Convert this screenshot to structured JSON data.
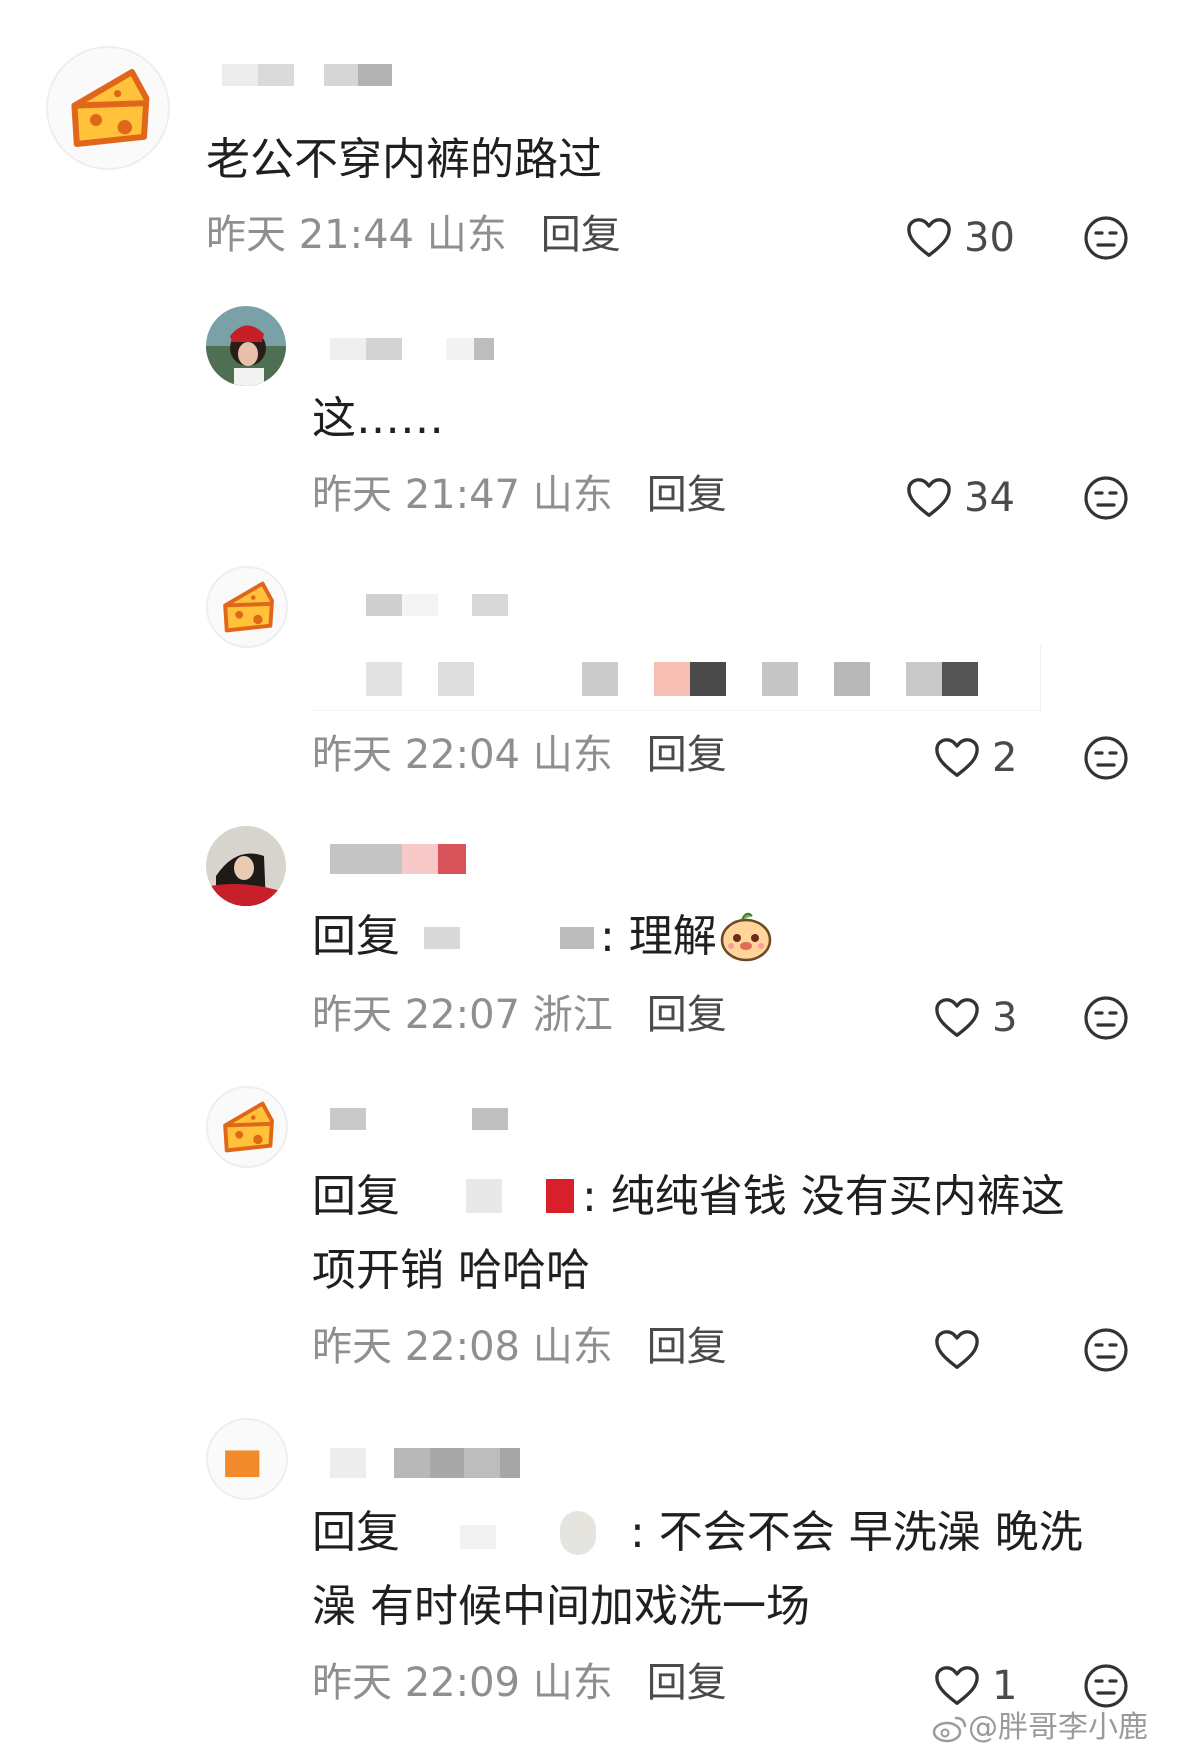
{
  "comments": [
    {
      "text": "老公不穿内裤的路过",
      "meta": "昨天 21:44 山东",
      "reply_label": "回复",
      "likes": "30",
      "avatar": "cheese-icon"
    },
    {
      "text": "这……",
      "meta": "昨天 21:47 山东",
      "reply_label": "回复",
      "likes": "34",
      "avatar": "user-photo"
    },
    {
      "text": "",
      "meta": "昨天 22:04 山东",
      "reply_label": "回复",
      "likes": "2",
      "avatar": "cheese-icon"
    },
    {
      "reply_prefix": "回复",
      "text": ": 理解",
      "meta": "昨天 22:07 浙江",
      "reply_label": "回复",
      "likes": "3",
      "avatar": "user-photo"
    },
    {
      "reply_prefix": "回复",
      "text_line1": ": 纯纯省钱 没有买内裤这",
      "text_line2": "项开销 哈哈哈",
      "meta": "昨天 22:08 山东",
      "reply_label": "回复",
      "likes": "",
      "avatar": "cheese-icon"
    },
    {
      "reply_prefix": "回复",
      "text_line1": ": 不会不会 早洗澡 晚洗",
      "text_line2": "澡 有时候中间加戏洗一场",
      "meta": "昨天 22:09 山东",
      "reply_label": "回复",
      "likes": "1",
      "avatar": "blurred"
    }
  ],
  "icons": {
    "like": "heart-outline-icon",
    "dislike": "meh-face-icon",
    "emoji": "dog-face-emoji",
    "watermark": "weibo-logo-icon"
  },
  "colors": {
    "cheese": "#ffc23a",
    "cheese_outline": "#e0661a",
    "meta_gray": "#8f8f8f",
    "text": "#1f1f1f"
  },
  "watermark": "@胖哥李小鹿"
}
